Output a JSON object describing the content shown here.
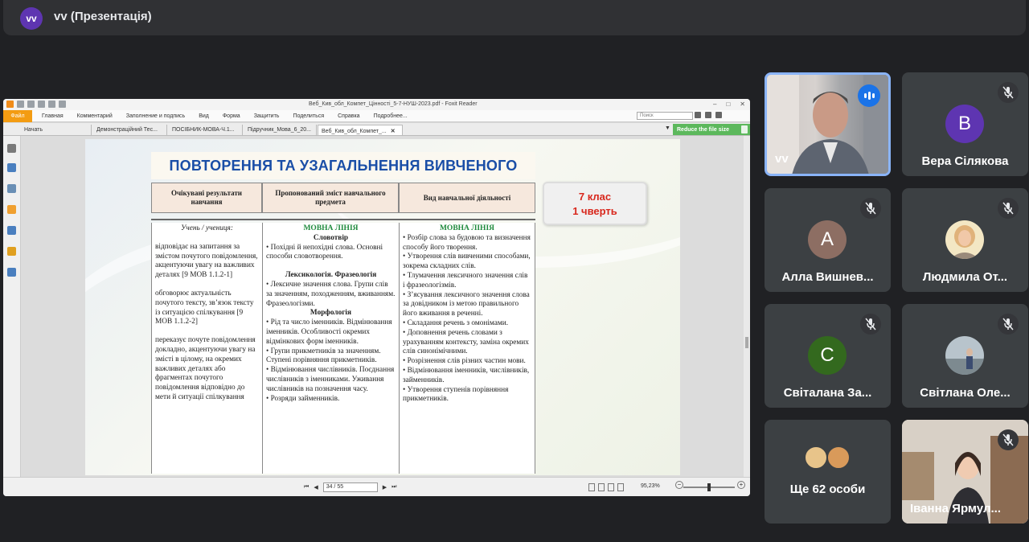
{
  "meeting": {
    "presenter_initials": "vv",
    "title": "vv (Презентація)"
  },
  "reader": {
    "window_title": "Веб_Кив_обл_Компет_Цінності_5-7-НУШ-2023.pdf - Foxit Reader",
    "file_tab": "Файл",
    "menu": [
      "Главная",
      "Комментарий",
      "Заполнение и подпись",
      "Вид",
      "Форма",
      "Защитить",
      "Поделиться",
      "Справка",
      "Подробнее..."
    ],
    "search_placeholder": "Поиск",
    "tabs": [
      {
        "label": "Начать"
      },
      {
        "label": "Демонстраційний Тес..."
      },
      {
        "label": "ПОСІБНИК-МОВА-Ч.1..."
      },
      {
        "label": "Підручник_Мова_6_20..."
      },
      {
        "label": "Веб_Кив_обл_Компет_..."
      }
    ],
    "reduce_label": "Reduce the file size",
    "page_field": "34 / 55",
    "zoom": "95,23%"
  },
  "slide": {
    "title": "ПОВТОРЕННЯ ТА УЗАГАЛЬНЕННЯ ВИВЧЕНОГО",
    "grade_line1": "7 клас",
    "grade_line2": "1 чверть",
    "headers": [
      "Очікувані результати навчання",
      "Пропонований зміст навчального предмета",
      "Вид навчальної діяльності"
    ],
    "col1": {
      "intro": "Учень / учениця:",
      "blocks": [
        "відповідає на запитання за змістом почутого повідомлення, акцентуючи увагу на важливих деталях [9 МОВ 1.1.2-1]",
        "обговорює актуальність почутого тексту, зв’язок тексту із ситуацією спілкування [9 МОВ 1.1.2-2]",
        "переказує почуте повідомлення докладно, акцентуючи увагу на змісті в цілому, на окремих важливих деталях або фрагментах почутого повідомлення відповідно до мети й ситуації спілкування"
      ]
    },
    "col2": {
      "heading": "МОВНА ЛІНІЯ",
      "sections": [
        {
          "title": "Словотвір",
          "items": [
            "Похідні й непохідні слова. Основні способи словотворення."
          ]
        },
        {
          "title": "Лексикологія. Фразеологія",
          "items": [
            "Лексичне значення слова. Групи слів за значенням, походженням, вживанням. Фразеологізми."
          ]
        },
        {
          "title": "Морфологія",
          "items": [
            "Рід та число іменників. Відмінювання іменників. Особливості окремих відмінкових форм іменників.",
            "Групи прикметників за значенням. Ступені порівняння прикметників.",
            "Відмінювання числівників. Поєднання числівників з іменниками. Уживання числівників на позначення часу.",
            "Розряди займенників."
          ]
        }
      ]
    },
    "col3": {
      "heading": "МОВНА ЛІНІЯ",
      "items": [
        "Розбір слова за будовою та визначення способу його творення.",
        "Утворення слів вивченими способами, зокрема складних слів.",
        "Тлумачення лексичного значення слів і фразеологізмів.",
        "З’ясування лексичного значення слова за довідником із метою правильного його вживання в реченні.",
        "Складання речень з омонімами.",
        "Доповнення речень словами з урахуванням контексту, заміна окремих слів синонімічними.",
        "Розрізнення слів різних частин мови.",
        "Відмінювання іменників, числівників, займенників.",
        "Утворення ступенів порівняння прикметників."
      ]
    }
  },
  "participants": [
    {
      "name": "vv",
      "type": "video",
      "speaking": true
    },
    {
      "name": "Вера Сілякова",
      "initial": "В",
      "color": "#5e35b1",
      "muted": true
    },
    {
      "name": "Алла Вишнев...",
      "initial": "А",
      "color": "#8d6e63",
      "muted": true
    },
    {
      "name": "Людмила От...",
      "type": "photo",
      "muted": true
    },
    {
      "name": "Світалана За...",
      "initial": "С",
      "color": "#33691e",
      "muted": true
    },
    {
      "name": "Світлана Оле...",
      "type": "photo",
      "muted": true
    },
    {
      "name": "Ще 62 особи",
      "type": "more"
    },
    {
      "name": "Іванна Ярмул...",
      "type": "video",
      "muted": true
    }
  ]
}
